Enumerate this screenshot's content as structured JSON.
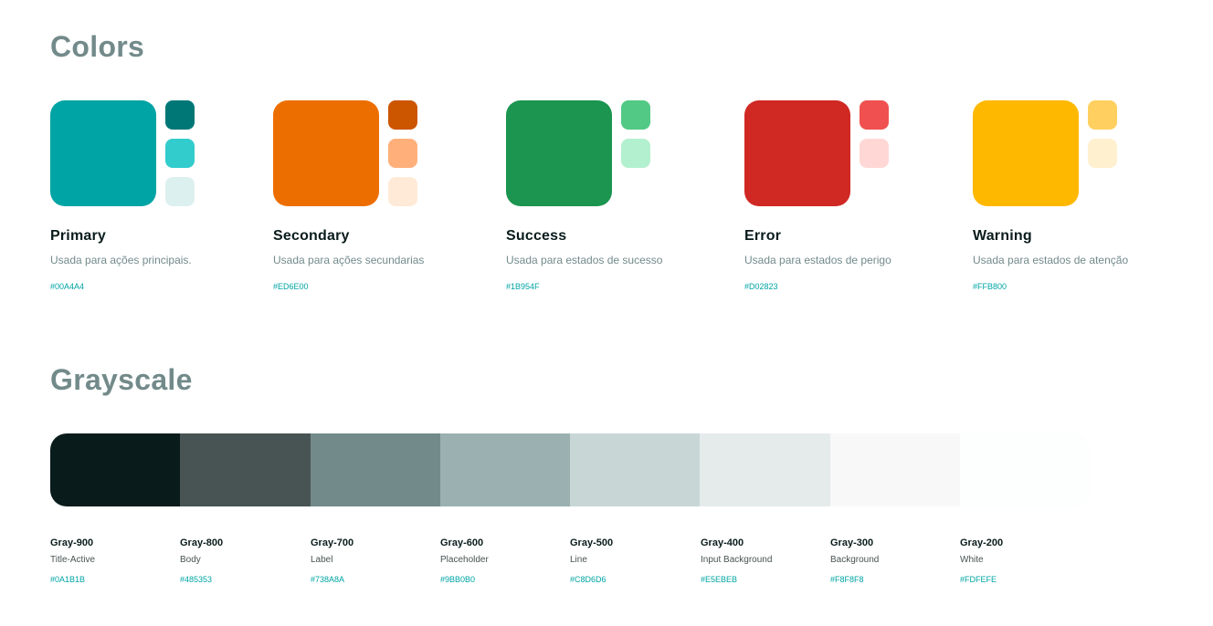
{
  "colors": {
    "title": "Colors",
    "groups": [
      {
        "name": "Primary",
        "description": "Usada para ações principais.",
        "hex": "#00A4A4",
        "main": "#00A4A4",
        "variants": [
          "#007777",
          "#33CCCC",
          "#DDF0F0"
        ]
      },
      {
        "name": "Secondary",
        "description": "Usada para ações secundarias",
        "hex": "#ED6E00",
        "main": "#ED6E00",
        "variants": [
          "#CC5500",
          "#FFB07A",
          "#FFEAD8"
        ]
      },
      {
        "name": "Success",
        "description": "Usada para estados de sucesso",
        "hex": "#1B954F",
        "main": "#1B954F",
        "variants": [
          "#52C985",
          "#B3F0CF"
        ]
      },
      {
        "name": "Error",
        "description": "Usada para estados de perigo",
        "hex": "#D02823",
        "main": "#D02823",
        "variants": [
          "#F05050",
          "#FFD7D5"
        ]
      },
      {
        "name": "Warning",
        "description": "Usada para estados de atenção",
        "hex": "#FFB800",
        "main": "#FFB800",
        "variants": [
          "#FFD060",
          "#FFF0CF"
        ]
      }
    ]
  },
  "grayscale": {
    "title": "Grayscale",
    "items": [
      {
        "name": "Gray-900",
        "role": "Title-Active",
        "hex": "#0A1B1B",
        "color": "#0A1B1B"
      },
      {
        "name": "Gray-800",
        "role": "Body",
        "hex": "#485353",
        "color": "#485353"
      },
      {
        "name": "Gray-700",
        "role": "Label",
        "hex": "#738A8A",
        "color": "#738A8A"
      },
      {
        "name": "Gray-600",
        "role": "Placeholder",
        "hex": "#9BB0B0",
        "color": "#9BB0B0"
      },
      {
        "name": "Gray-500",
        "role": "Line",
        "hex": "#C8D6D6",
        "color": "#C8D6D6"
      },
      {
        "name": "Gray-400",
        "role": "Input Background",
        "hex": "#E5EBEB",
        "color": "#E5EBEB"
      },
      {
        "name": "Gray-300",
        "role": "Background",
        "hex": "#F8F8F8",
        "color": "#F8F8F8"
      },
      {
        "name": "Gray-200",
        "role": "White",
        "hex": "#FDFEFE",
        "color": "#FDFEFE"
      }
    ]
  }
}
